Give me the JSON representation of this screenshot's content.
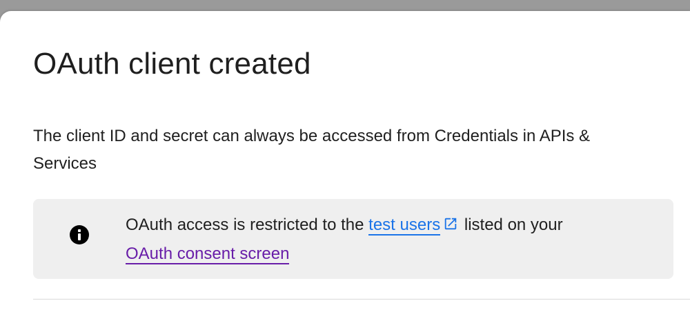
{
  "dialog": {
    "title": "OAuth client created",
    "description": "The client ID and secret can always be accessed from Credentials in APIs & Services"
  },
  "info_box": {
    "icon": "info-icon",
    "text_before": "OAuth access is restricted to the ",
    "test_users_link": "test users",
    "external_link_icon": "external-link-icon",
    "text_middle": " listed on your ",
    "consent_screen_link": "OAuth consent screen"
  },
  "colors": {
    "link": "#1a73e8",
    "visited_link": "#681da8",
    "info_box_background": "#efefef",
    "backdrop": "#9a9a9a"
  }
}
